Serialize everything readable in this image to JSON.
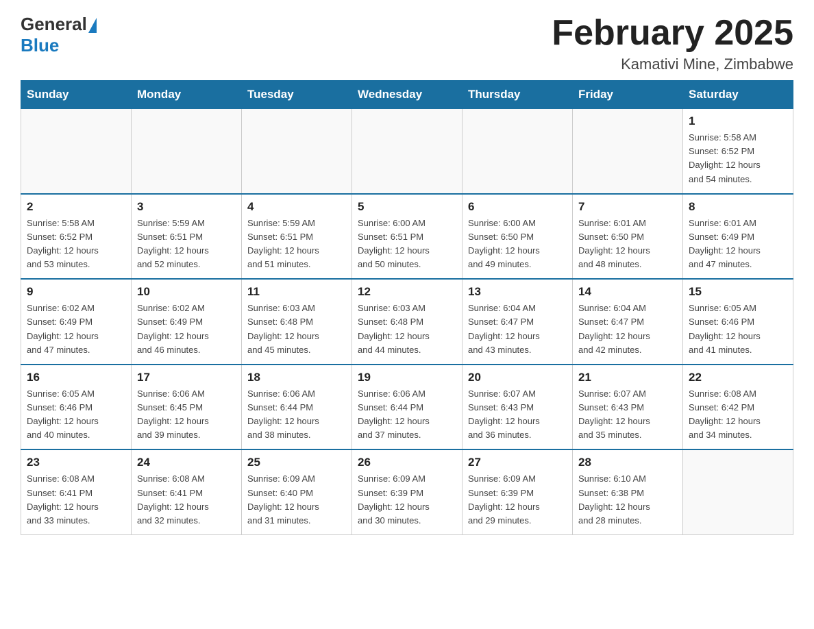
{
  "logo": {
    "general": "General",
    "blue": "Blue"
  },
  "header": {
    "title": "February 2025",
    "location": "Kamativi Mine, Zimbabwe"
  },
  "weekdays": [
    "Sunday",
    "Monday",
    "Tuesday",
    "Wednesday",
    "Thursday",
    "Friday",
    "Saturday"
  ],
  "weeks": [
    [
      {
        "day": "",
        "info": ""
      },
      {
        "day": "",
        "info": ""
      },
      {
        "day": "",
        "info": ""
      },
      {
        "day": "",
        "info": ""
      },
      {
        "day": "",
        "info": ""
      },
      {
        "day": "",
        "info": ""
      },
      {
        "day": "1",
        "info": "Sunrise: 5:58 AM\nSunset: 6:52 PM\nDaylight: 12 hours\nand 54 minutes."
      }
    ],
    [
      {
        "day": "2",
        "info": "Sunrise: 5:58 AM\nSunset: 6:52 PM\nDaylight: 12 hours\nand 53 minutes."
      },
      {
        "day": "3",
        "info": "Sunrise: 5:59 AM\nSunset: 6:51 PM\nDaylight: 12 hours\nand 52 minutes."
      },
      {
        "day": "4",
        "info": "Sunrise: 5:59 AM\nSunset: 6:51 PM\nDaylight: 12 hours\nand 51 minutes."
      },
      {
        "day": "5",
        "info": "Sunrise: 6:00 AM\nSunset: 6:51 PM\nDaylight: 12 hours\nand 50 minutes."
      },
      {
        "day": "6",
        "info": "Sunrise: 6:00 AM\nSunset: 6:50 PM\nDaylight: 12 hours\nand 49 minutes."
      },
      {
        "day": "7",
        "info": "Sunrise: 6:01 AM\nSunset: 6:50 PM\nDaylight: 12 hours\nand 48 minutes."
      },
      {
        "day": "8",
        "info": "Sunrise: 6:01 AM\nSunset: 6:49 PM\nDaylight: 12 hours\nand 47 minutes."
      }
    ],
    [
      {
        "day": "9",
        "info": "Sunrise: 6:02 AM\nSunset: 6:49 PM\nDaylight: 12 hours\nand 47 minutes."
      },
      {
        "day": "10",
        "info": "Sunrise: 6:02 AM\nSunset: 6:49 PM\nDaylight: 12 hours\nand 46 minutes."
      },
      {
        "day": "11",
        "info": "Sunrise: 6:03 AM\nSunset: 6:48 PM\nDaylight: 12 hours\nand 45 minutes."
      },
      {
        "day": "12",
        "info": "Sunrise: 6:03 AM\nSunset: 6:48 PM\nDaylight: 12 hours\nand 44 minutes."
      },
      {
        "day": "13",
        "info": "Sunrise: 6:04 AM\nSunset: 6:47 PM\nDaylight: 12 hours\nand 43 minutes."
      },
      {
        "day": "14",
        "info": "Sunrise: 6:04 AM\nSunset: 6:47 PM\nDaylight: 12 hours\nand 42 minutes."
      },
      {
        "day": "15",
        "info": "Sunrise: 6:05 AM\nSunset: 6:46 PM\nDaylight: 12 hours\nand 41 minutes."
      }
    ],
    [
      {
        "day": "16",
        "info": "Sunrise: 6:05 AM\nSunset: 6:46 PM\nDaylight: 12 hours\nand 40 minutes."
      },
      {
        "day": "17",
        "info": "Sunrise: 6:06 AM\nSunset: 6:45 PM\nDaylight: 12 hours\nand 39 minutes."
      },
      {
        "day": "18",
        "info": "Sunrise: 6:06 AM\nSunset: 6:44 PM\nDaylight: 12 hours\nand 38 minutes."
      },
      {
        "day": "19",
        "info": "Sunrise: 6:06 AM\nSunset: 6:44 PM\nDaylight: 12 hours\nand 37 minutes."
      },
      {
        "day": "20",
        "info": "Sunrise: 6:07 AM\nSunset: 6:43 PM\nDaylight: 12 hours\nand 36 minutes."
      },
      {
        "day": "21",
        "info": "Sunrise: 6:07 AM\nSunset: 6:43 PM\nDaylight: 12 hours\nand 35 minutes."
      },
      {
        "day": "22",
        "info": "Sunrise: 6:08 AM\nSunset: 6:42 PM\nDaylight: 12 hours\nand 34 minutes."
      }
    ],
    [
      {
        "day": "23",
        "info": "Sunrise: 6:08 AM\nSunset: 6:41 PM\nDaylight: 12 hours\nand 33 minutes."
      },
      {
        "day": "24",
        "info": "Sunrise: 6:08 AM\nSunset: 6:41 PM\nDaylight: 12 hours\nand 32 minutes."
      },
      {
        "day": "25",
        "info": "Sunrise: 6:09 AM\nSunset: 6:40 PM\nDaylight: 12 hours\nand 31 minutes."
      },
      {
        "day": "26",
        "info": "Sunrise: 6:09 AM\nSunset: 6:39 PM\nDaylight: 12 hours\nand 30 minutes."
      },
      {
        "day": "27",
        "info": "Sunrise: 6:09 AM\nSunset: 6:39 PM\nDaylight: 12 hours\nand 29 minutes."
      },
      {
        "day": "28",
        "info": "Sunrise: 6:10 AM\nSunset: 6:38 PM\nDaylight: 12 hours\nand 28 minutes."
      },
      {
        "day": "",
        "info": ""
      }
    ]
  ]
}
